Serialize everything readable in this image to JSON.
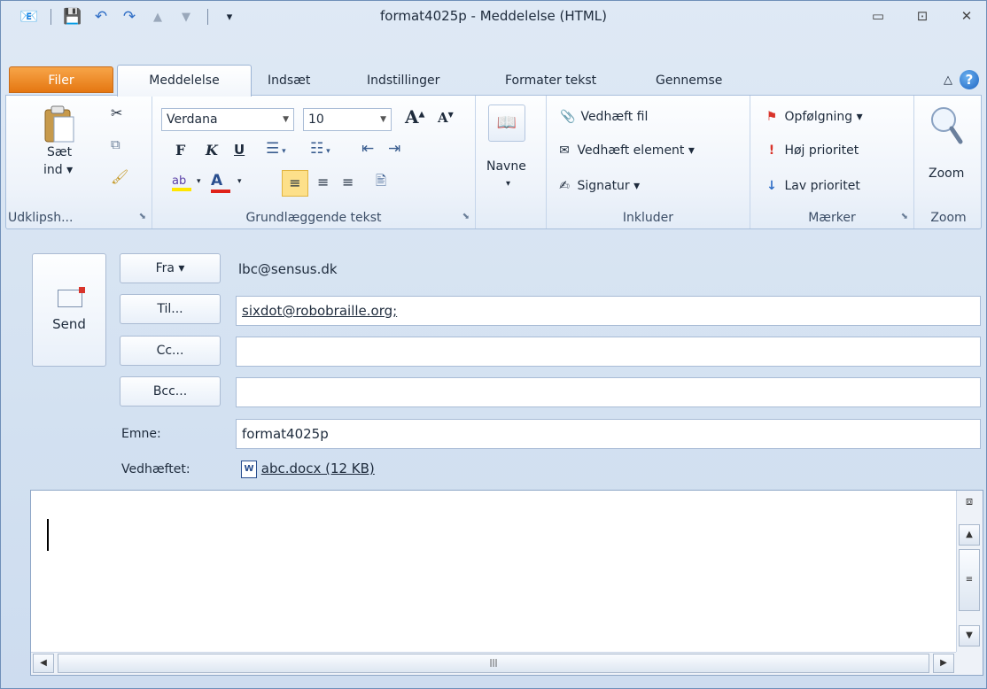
{
  "window": {
    "title": "format4025p  -  Meddelelse (HTML)",
    "buttons": {
      "minimize": "▭",
      "maximize": "⊡",
      "close": "✕"
    }
  },
  "qat": {
    "icons": [
      "outlook-icon",
      "save-icon",
      "undo-icon",
      "redo-icon",
      "up-arrow-icon",
      "down-arrow-icon",
      "customize-icon"
    ]
  },
  "tabs": {
    "file": "Filer",
    "items": [
      "Meddelelse",
      "Indsæt",
      "Indstillinger",
      "Formater tekst",
      "Gennemse"
    ]
  },
  "ribbon": {
    "clipboard": {
      "paste": "Sæt",
      "paste2": "ind ▾",
      "label": "Udklipsh..."
    },
    "basic_text": {
      "font": "Verdana",
      "size": "10",
      "bold": "F",
      "italic": "K",
      "underline": "U",
      "label": "Grundlæggende tekst"
    },
    "names": {
      "label": "Navne",
      "arrow": "▾"
    },
    "include": {
      "attach_file": "Vedhæft fil",
      "attach_item": "Vedhæft element ▾",
      "signature": "Signatur ▾",
      "label": "Inkluder"
    },
    "tags": {
      "followup": "Opfølgning ▾",
      "high": "Høj prioritet",
      "low": "Lav prioritet",
      "label": "Mærker"
    },
    "zoom": {
      "button": "Zoom",
      "label": "Zoom"
    }
  },
  "compose": {
    "send": "Send",
    "from_btn": "Fra ▾",
    "from_value": "lbc@sensus.dk",
    "to_btn": "Til...",
    "to_value": "sixdot@robobraille.org;",
    "cc_btn": "Cc...",
    "cc_value": "",
    "bcc_btn": "Bcc...",
    "bcc_value": "",
    "subject_label": "Emne:",
    "subject_value": "format4025p",
    "attached_label": "Vedhæftet:",
    "attachment": "abc.docx (12 KB)"
  },
  "colors": {
    "file_tab": "#e57712",
    "highlight": "#ffe600",
    "font_color": "#e0221a",
    "accent": "#1c64c2"
  }
}
